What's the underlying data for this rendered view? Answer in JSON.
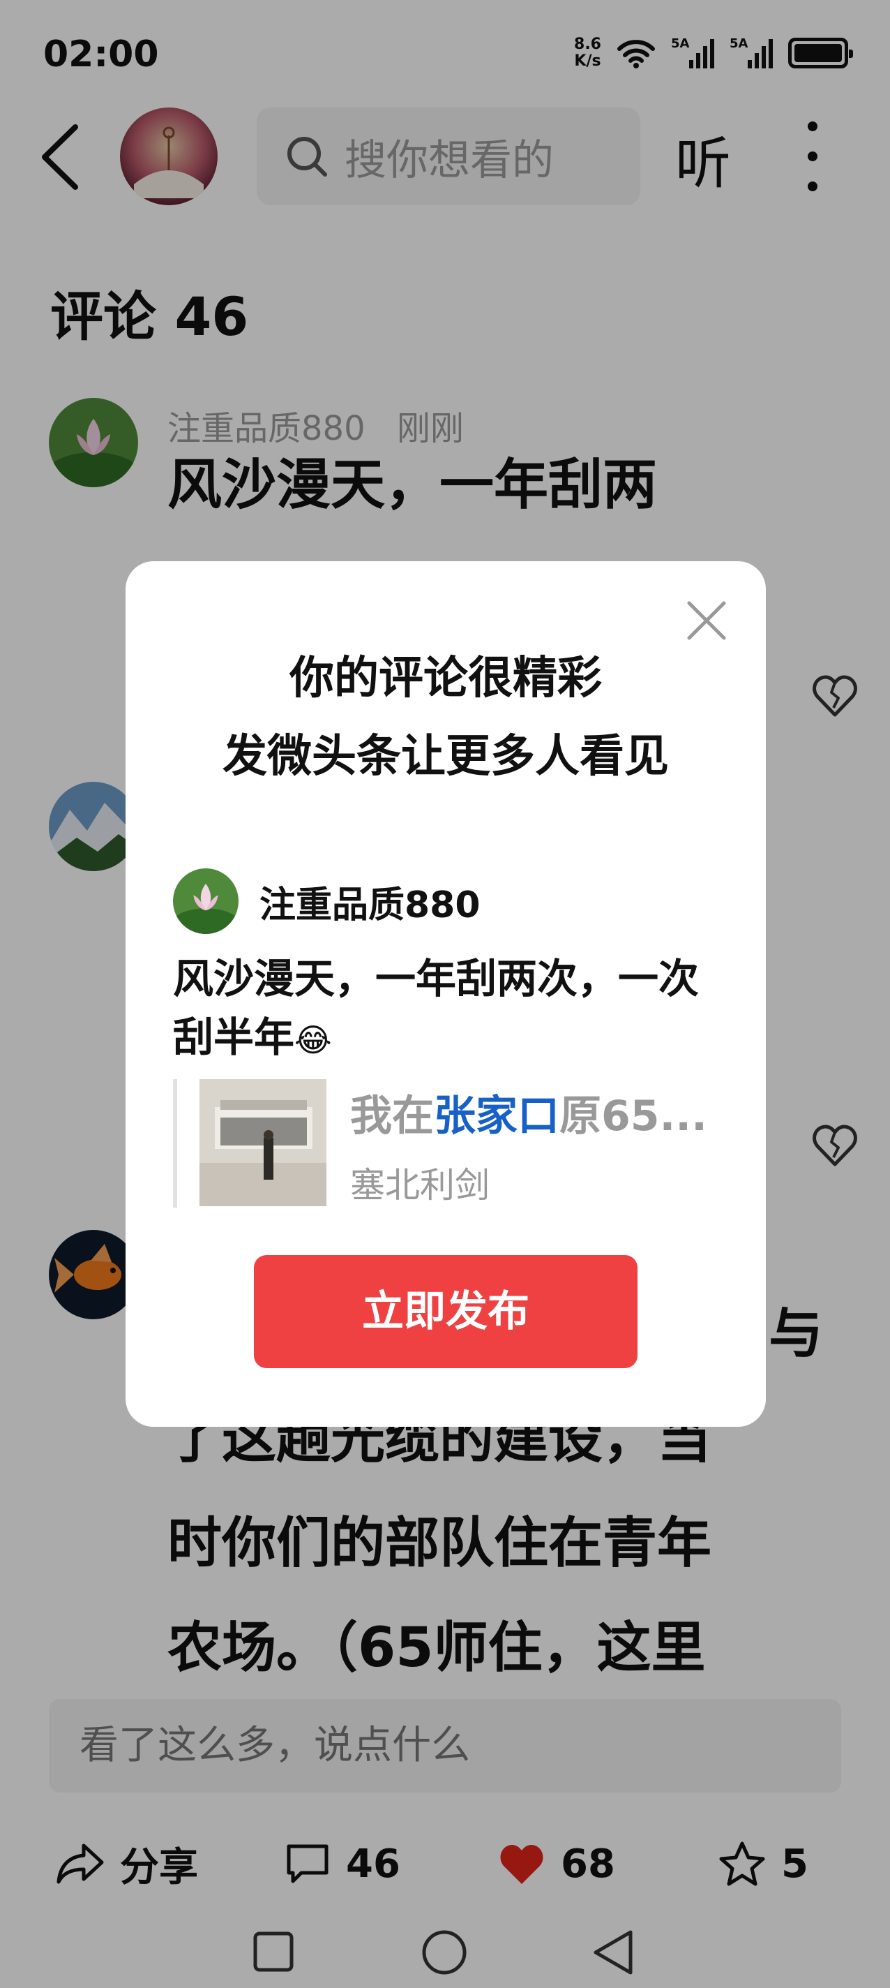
{
  "status": {
    "time": "02:00",
    "net_speed_value": "8.6",
    "net_speed_unit": "K/s",
    "sim1": "5A",
    "sim2": "5A"
  },
  "nav": {
    "search_placeholder": "搜你想看的",
    "listen_label": "听"
  },
  "comments": {
    "title": "评论 46",
    "items": [
      {
        "user": "注重品质880",
        "time": "刚刚",
        "text": "风沙漫天，一年刮两"
      },
      {
        "text_lines": [
          "与",
          "了这趟光缆的建设，当",
          "时你们的部队住在青年",
          "农场。（65师住，这里"
        ]
      }
    ]
  },
  "input": {
    "placeholder": "看了这么多，说点什么"
  },
  "actions": {
    "share_label": "分享",
    "comment_count": "46",
    "like_count": "68",
    "favorite_count": "5"
  },
  "dialog": {
    "title_line1": "你的评论很精彩",
    "title_line2": "发微头条让更多人看见",
    "user": "注重品质880",
    "comment_text": "风沙漫天，一年刮两次，一次刮半年",
    "emoji": "😂",
    "quote_prefix": "我在",
    "quote_highlight": "张家口",
    "quote_suffix": "原65...",
    "quote_author": "塞北利剑",
    "publish_label": "立即发布"
  },
  "colors": {
    "accent_red": "#f04142",
    "link_blue": "#1760c8",
    "like_red": "#e2231a"
  }
}
